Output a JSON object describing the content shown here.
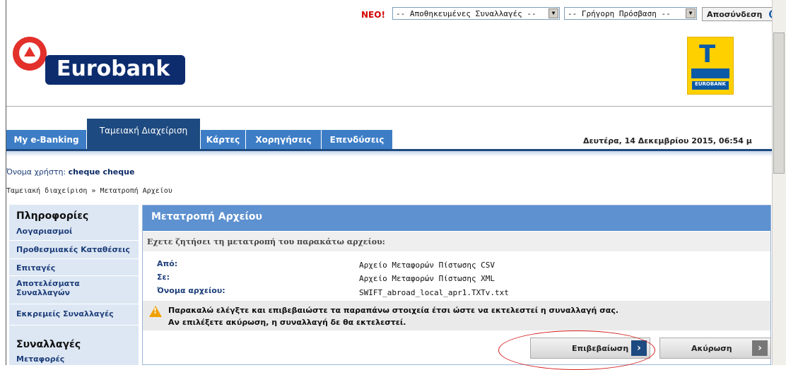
{
  "topbar": {
    "new_label": "ΝΕΟ!",
    "saved_transactions": "-- Αποθηκευμένες Συναλλαγές --",
    "quick_access": "-- Γρήγορη Πρόσβαση --",
    "logout": "Αποσύνδεση"
  },
  "brand": {
    "logo_text": "Eurobank",
    "badge_text": "EUROBANK"
  },
  "tabs": [
    {
      "label": "My e-Banking"
    },
    {
      "label": "Ταμειακή Διαχείριση"
    },
    {
      "label": "Κάρτες"
    },
    {
      "label": "Χορηγήσεις"
    },
    {
      "label": "Επενδύσεις"
    }
  ],
  "date": "Δευτέρα, 14 Δεκεμβρίου 2015, 06:54 μ",
  "user": {
    "prefix": "Όνομα χρήστη: ",
    "name": "cheque cheque"
  },
  "breadcrumb": "Ταμειακή διαχείριση » Μετατροπή Αρχείου",
  "sidebar": {
    "section1": "Πληροφορίες",
    "items1": [
      "Λογαριασμοί",
      "Προθεσμιακές Καταθέσεις",
      "Επιταγές",
      "Αποτελέσματα Συναλλαγών",
      "Εκκρεμείς Συναλλαγές"
    ],
    "section2": "Συναλλαγές",
    "items2": [
      "Μεταφορές"
    ]
  },
  "panel": {
    "title": "Μετατροπή Αρχείου",
    "intro": "Εχετε ζητήσει τη μετατροπή του παρακάτω αρχείου:",
    "fields": [
      {
        "label": "Από:",
        "value": "Αρχείο Μεταφορών Πίστωσης CSV"
      },
      {
        "label": "Σε:",
        "value": "Αρχείο Μεταφορών Πίστωσης XML"
      },
      {
        "label": "Όνομα αρχείου:",
        "value": "SWIFT_abroad_local_apr1.TXTv.txt"
      }
    ],
    "warning_line1": "Παρακαλώ ελέγξτε και επιβεβαιώστε τα παραπάνω στοιχεία έτσι ώστε να εκτελεστεί η συναλλαγή σας.",
    "warning_line2": "Αν επιλέξετε ακύρωση, η συναλλαγή δε θα εκτελεστεί.",
    "confirm_label": "Επιβεβαίωση",
    "cancel_label": "Ακύρωση"
  },
  "colors": {
    "accent": "#3d7dc6",
    "active_tab": "#1d4a80",
    "highlight": "#d61f1f"
  }
}
